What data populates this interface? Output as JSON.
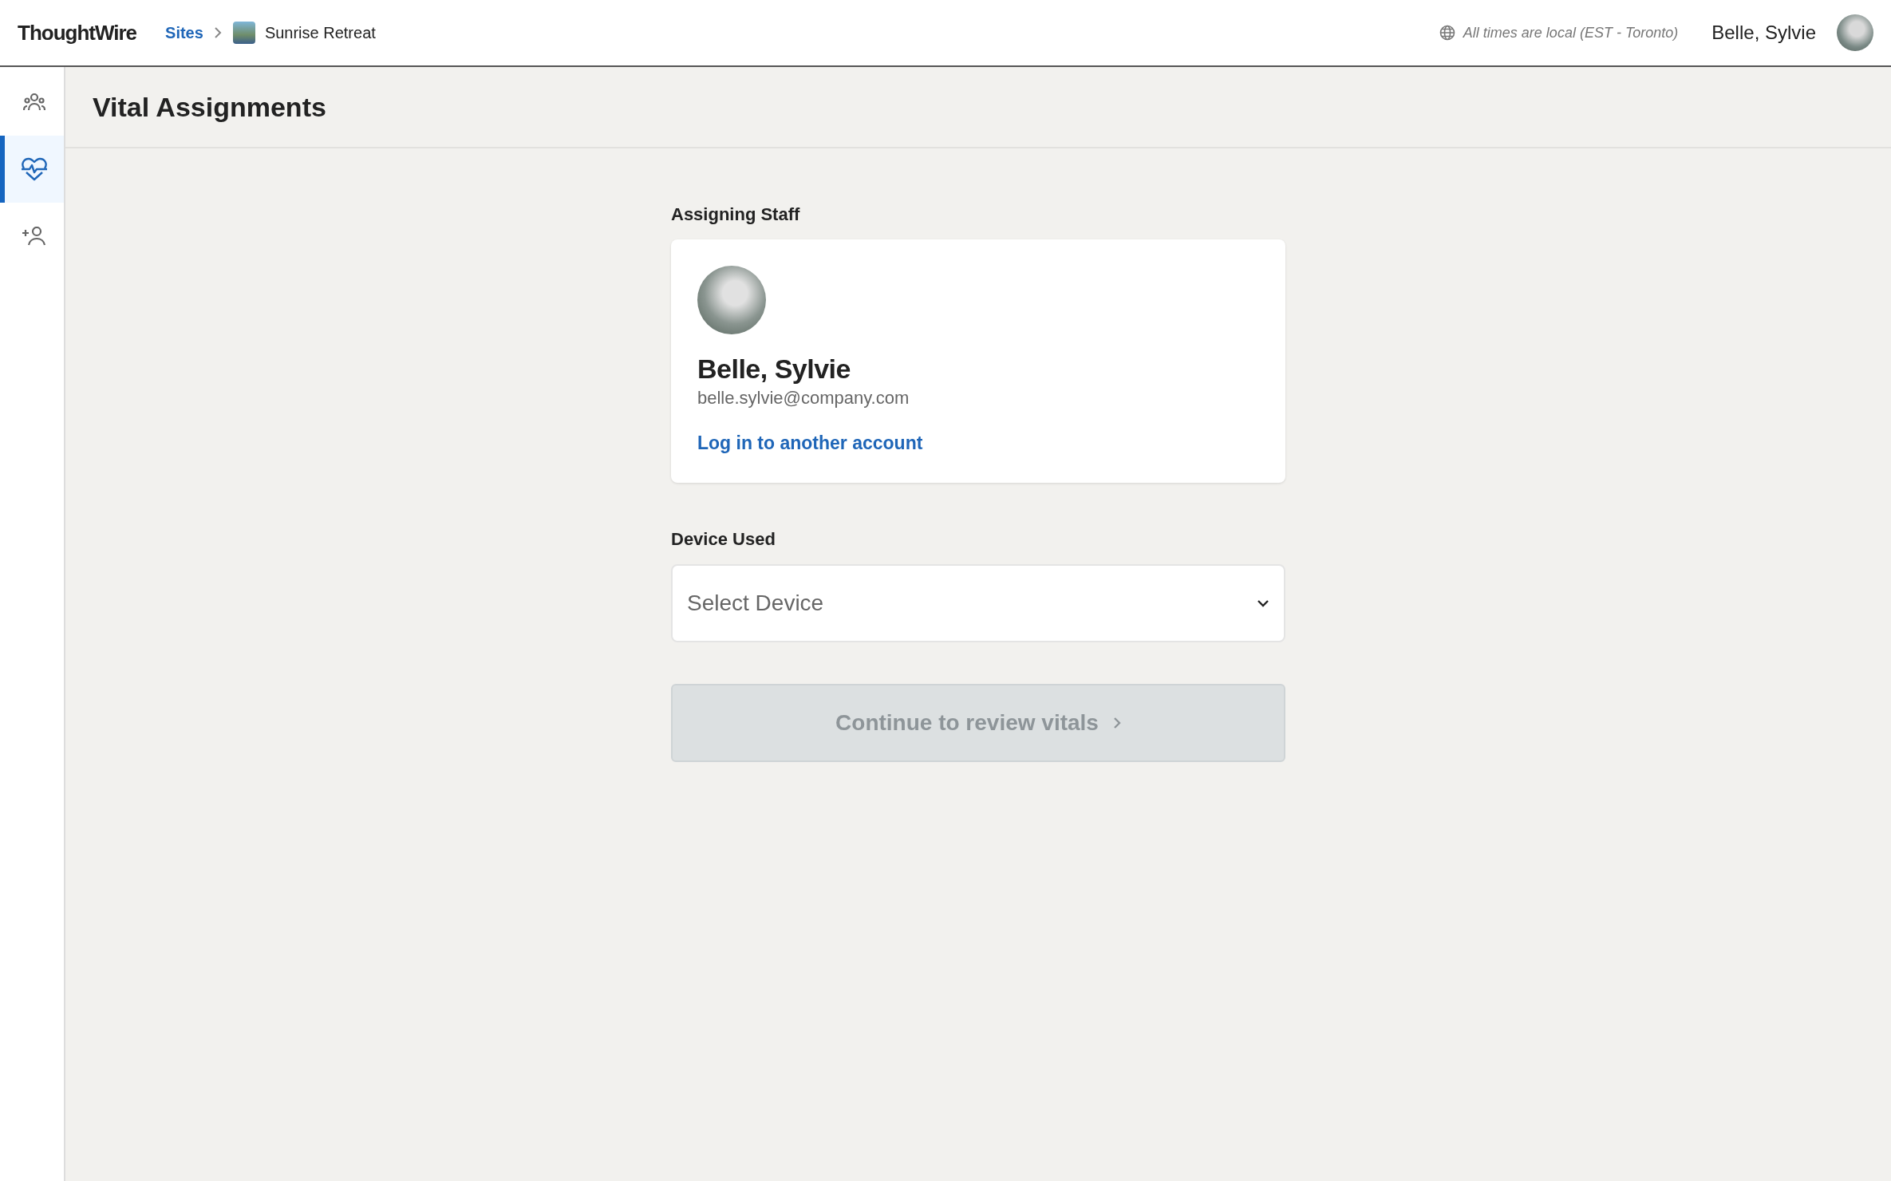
{
  "header": {
    "logo": "ThoughtWire",
    "breadcrumb": {
      "link": "Sites",
      "current": "Sunrise Retreat"
    },
    "timezone_note": "All times are local (EST  - Toronto)",
    "user_name": "Belle, Sylvie"
  },
  "sidebar": {
    "items": [
      {
        "kind": "residents",
        "selected": false
      },
      {
        "kind": "vitals",
        "selected": true
      },
      {
        "kind": "add-person",
        "selected": false
      }
    ]
  },
  "page_title": "Vital Assignments",
  "staff_section": {
    "label": "Assigning Staff",
    "name": "Belle, Sylvie",
    "email": "belle.sylvie@company.com",
    "link": "Log in to another account"
  },
  "device_section": {
    "label": "Device Used",
    "placeholder": "Select Device"
  },
  "continue_button": {
    "label": "Continue to review vitals",
    "disabled": true
  }
}
